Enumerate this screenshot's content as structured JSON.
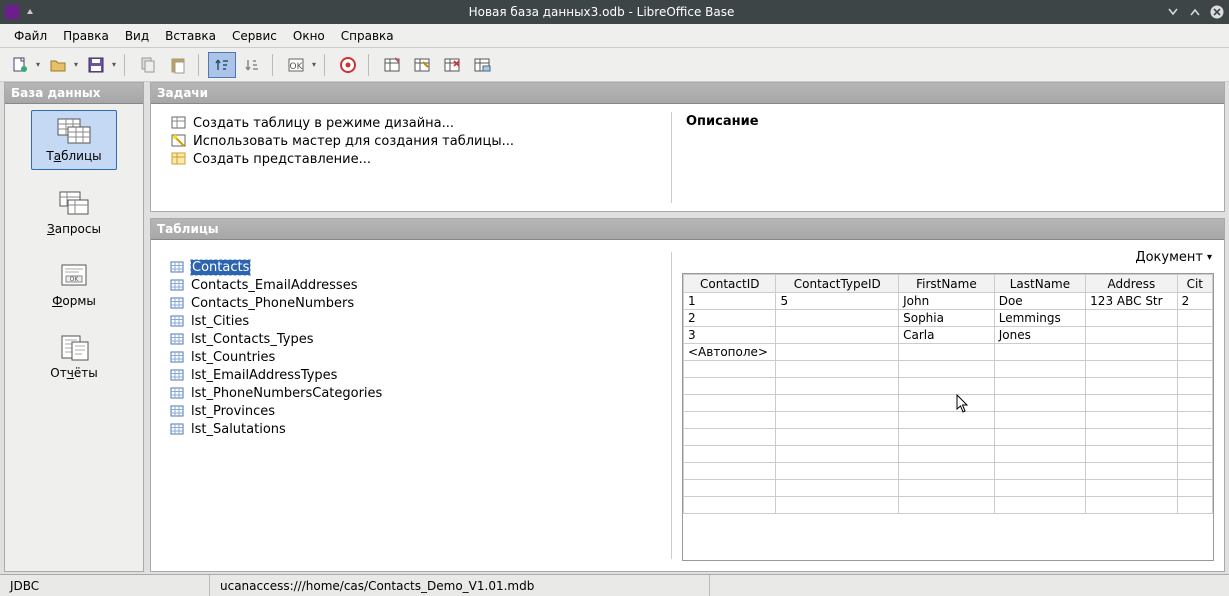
{
  "window": {
    "title": "Новая база данных3.odb - LibreOffice Base"
  },
  "menu": [
    "Файл",
    "Правка",
    "Вид",
    "Вставка",
    "Сервис",
    "Окно",
    "Справка"
  ],
  "sidebar": {
    "header": "База данных",
    "items": [
      {
        "label": "Таблицы",
        "key": "T",
        "selected": true
      },
      {
        "label": "Запросы",
        "key": "З",
        "selected": false
      },
      {
        "label": "Формы",
        "key": "Ф",
        "selected": false
      },
      {
        "label": "Отчёты",
        "key": "О",
        "selected": false
      }
    ]
  },
  "tasks": {
    "header": "Задачи",
    "items": [
      "Создать таблицу в режиме дизайна...",
      "Использовать мастер для создания таблицы...",
      "Создать представление..."
    ],
    "desc_label": "Описание"
  },
  "tables": {
    "header": "Таблицы",
    "items": [
      {
        "name": "Contacts",
        "selected": true
      },
      {
        "name": "Contacts_EmailAddresses"
      },
      {
        "name": "Contacts_PhoneNumbers"
      },
      {
        "name": "lst_Cities"
      },
      {
        "name": "lst_Contacts_Types"
      },
      {
        "name": "lst_Countries"
      },
      {
        "name": "lst_EmailAddressTypes"
      },
      {
        "name": "lst_PhoneNumbersCategories"
      },
      {
        "name": "lst_Provinces"
      },
      {
        "name": "lst_Salutations"
      }
    ]
  },
  "preview": {
    "selector_label": "Документ",
    "columns": [
      "ContactID",
      "ContactTypeID",
      "FirstName",
      "LastName",
      "Address",
      "Cit"
    ],
    "rows": [
      {
        "ContactID": "1",
        "ContactTypeID": "5",
        "FirstName": "John",
        "LastName": "Doe",
        "Address": "123 ABC Str",
        "Cit": "2"
      },
      {
        "ContactID": "2",
        "ContactTypeID": "",
        "FirstName": "Sophia",
        "LastName": "Lemmings",
        "Address": "",
        "Cit": ""
      },
      {
        "ContactID": "3",
        "ContactTypeID": "",
        "FirstName": "Carla",
        "LastName": "Jones",
        "Address": "",
        "Cit": ""
      }
    ],
    "new_row_label": "<Автополе>"
  },
  "status": {
    "driver": "JDBC",
    "path": "ucanaccess:///home/cas/Contacts_Demo_V1.01.mdb"
  }
}
